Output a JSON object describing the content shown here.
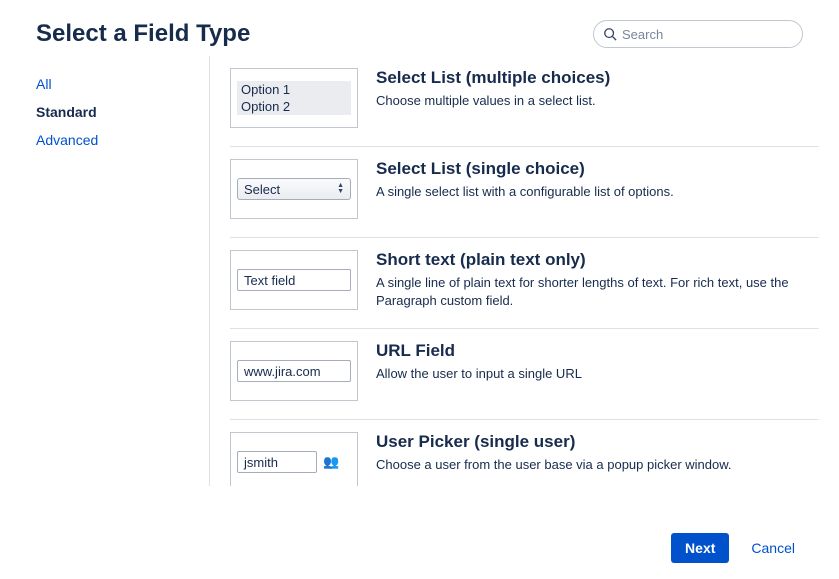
{
  "header": {
    "title": "Select a Field Type",
    "search_placeholder": "Search"
  },
  "sidebar": {
    "items": [
      {
        "label": "All",
        "selected": false
      },
      {
        "label": "Standard",
        "selected": true
      },
      {
        "label": "Advanced",
        "selected": false
      }
    ]
  },
  "field_types": [
    {
      "id": "select-multi",
      "title": "Select List (multiple choices)",
      "desc": "Choose multiple values in a select list.",
      "preview": {
        "kind": "multi",
        "options": [
          "Option 1",
          "Option 2"
        ]
      }
    },
    {
      "id": "select-single",
      "title": "Select List (single choice)",
      "desc": "A single select list with a configurable list of options.",
      "preview": {
        "kind": "select",
        "label": "Select"
      }
    },
    {
      "id": "short-text",
      "title": "Short text (plain text only)",
      "desc": "A single line of plain text for shorter lengths of text. For rich text, use the Paragraph custom field.",
      "preview": {
        "kind": "text",
        "value": "Text field"
      }
    },
    {
      "id": "url",
      "title": "URL Field",
      "desc": "Allow the user to input a single URL",
      "preview": {
        "kind": "text",
        "value": "www.jira.com"
      }
    },
    {
      "id": "user-picker",
      "title": "User Picker (single user)",
      "desc": "Choose a user from the user base via a popup picker window.",
      "preview": {
        "kind": "user",
        "value": "jsmith"
      }
    }
  ],
  "footer": {
    "next_label": "Next",
    "cancel_label": "Cancel"
  }
}
